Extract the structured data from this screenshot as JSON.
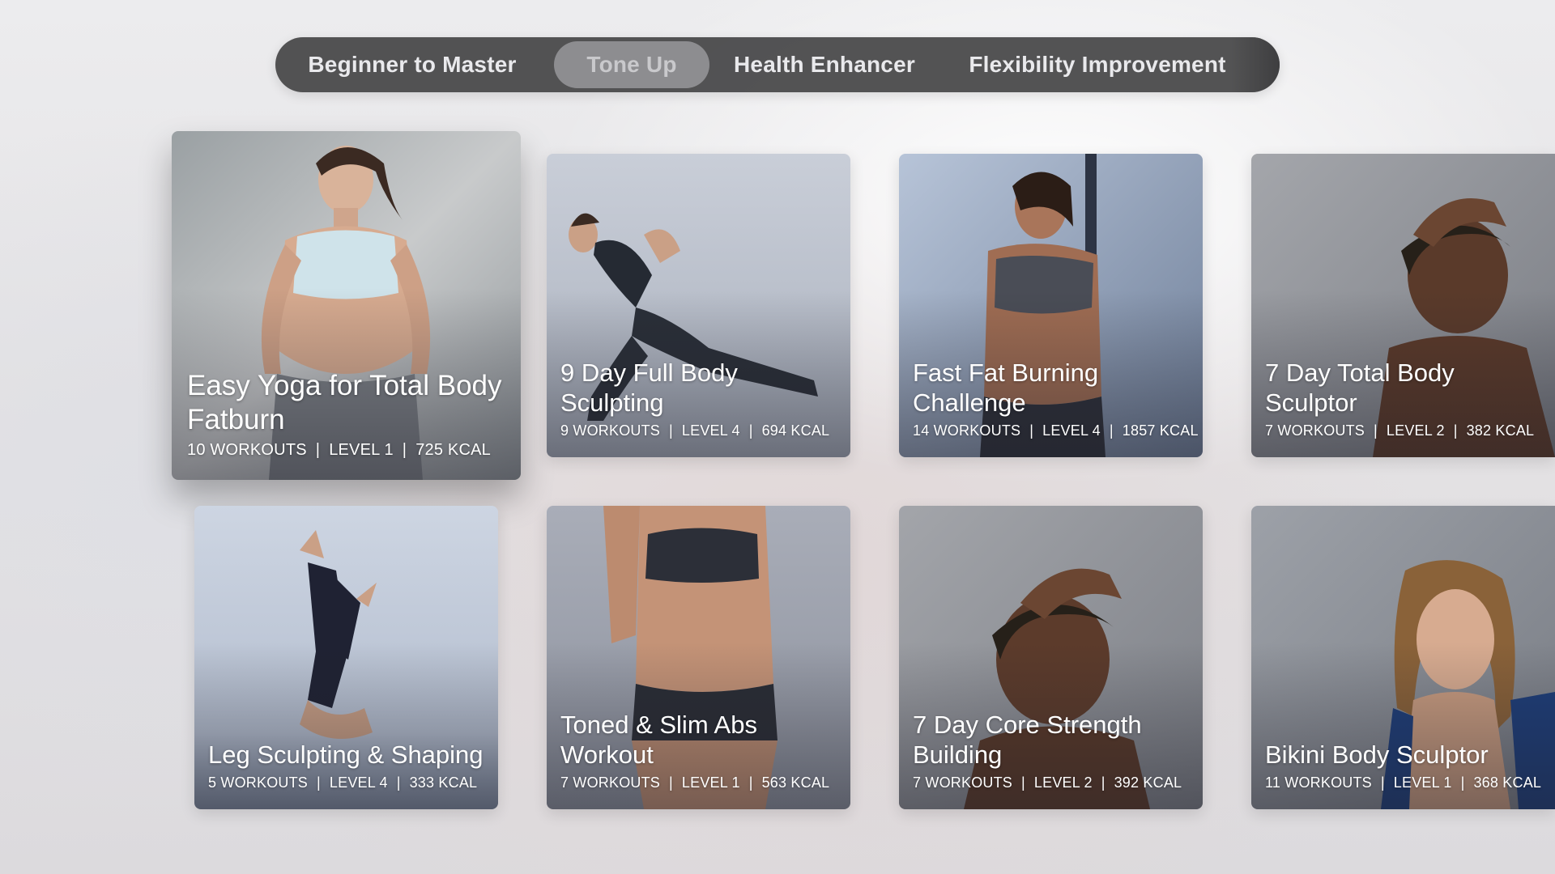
{
  "tabs": [
    {
      "label": "Beginner to Master",
      "active": false
    },
    {
      "label": "Tone Up",
      "active": true
    },
    {
      "label": "Health Enhancer",
      "active": false
    },
    {
      "label": "Flexibility Improvement",
      "active": false
    }
  ],
  "cards": [
    {
      "title": "Easy Yoga for Total Body Fatburn",
      "workouts": "10 WORKOUTS",
      "level": "LEVEL 1",
      "kcal": "725 KCAL",
      "focused": true
    },
    {
      "title": "9 Day Full Body Sculpting",
      "workouts": "9 WORKOUTS",
      "level": "LEVEL 4",
      "kcal": "694 KCAL"
    },
    {
      "title": "Fast Fat Burning Challenge",
      "workouts": "14 WORKOUTS",
      "level": "LEVEL 4",
      "kcal": "1857 KCAL"
    },
    {
      "title": "7 Day Total Body Sculptor",
      "workouts": "7 WORKOUTS",
      "level": "LEVEL 2",
      "kcal": "382 KCAL"
    },
    {
      "title": "Leg Sculpting & Shaping",
      "workouts": "5 WORKOUTS",
      "level": "LEVEL 4",
      "kcal": "333 KCAL"
    },
    {
      "title": "Toned & Slim Abs Workout",
      "workouts": "7 WORKOUTS",
      "level": "LEVEL 1",
      "kcal": "563 KCAL"
    },
    {
      "title": "7 Day Core Strength Building",
      "workouts": "7 WORKOUTS",
      "level": "LEVEL 2",
      "kcal": "392 KCAL"
    },
    {
      "title": "Bikini Body Sculptor",
      "workouts": "11 WORKOUTS",
      "level": "LEVEL 1",
      "kcal": "368 KCAL"
    }
  ],
  "meta_separator": "|"
}
